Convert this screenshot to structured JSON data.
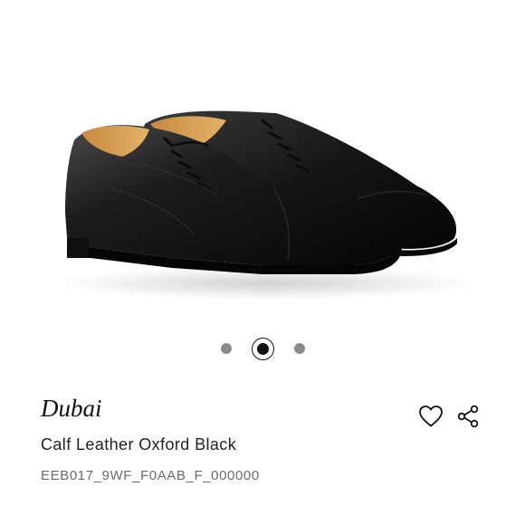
{
  "product": {
    "name": "Dubai",
    "description": "Calf Leather Oxford Black",
    "sku": "EEB017_9WF_F0AAB_F_000000"
  },
  "carousel": {
    "slide_count": 3,
    "active_index": 1
  },
  "icons": {
    "wishlist": "heart-icon",
    "share": "share-icon"
  },
  "colors": {
    "dot_inactive": "#8a8a8a",
    "dot_active": "#111111",
    "sku_text": "#6b6b6b"
  }
}
